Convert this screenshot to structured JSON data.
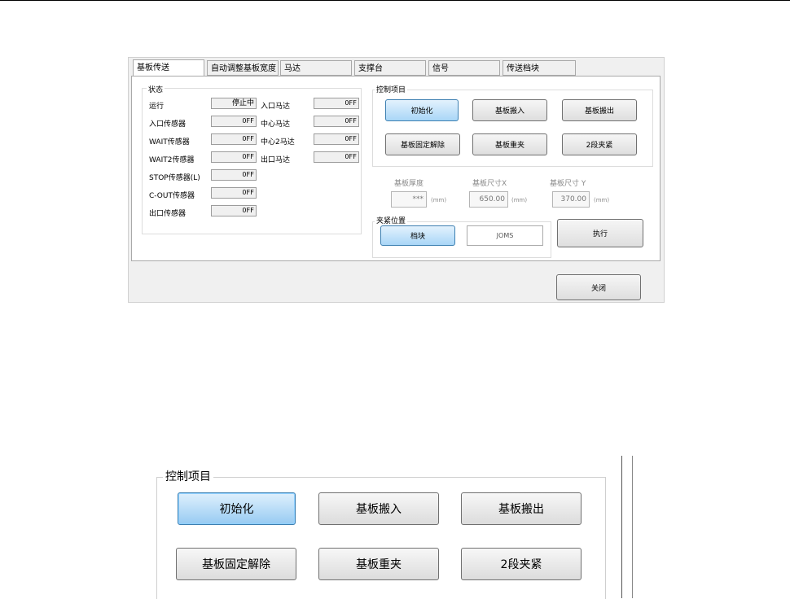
{
  "tabs": [
    "基板传送",
    "自动调整基板宽度",
    "马达",
    "支撑台",
    "信号",
    "传送档块"
  ],
  "status": {
    "title": "状态",
    "left": [
      {
        "label": "运行",
        "value": "停止中"
      },
      {
        "label": "入口传感器",
        "value": "OFF"
      },
      {
        "label": "WAIT传感器",
        "value": "OFF"
      },
      {
        "label": "WAIT2传感器",
        "value": "OFF"
      },
      {
        "label": "STOP传感器(L)",
        "value": "OFF"
      },
      {
        "label": "C-OUT传感器",
        "value": "OFF"
      },
      {
        "label": "出口传感器",
        "value": "OFF"
      }
    ],
    "right": [
      {
        "label": "入口马达",
        "value": "OFF"
      },
      {
        "label": "中心马达",
        "value": "OFF"
      },
      {
        "label": "中心2马达",
        "value": "OFF"
      },
      {
        "label": "出口马达",
        "value": "OFF"
      }
    ]
  },
  "control": {
    "title": "控制项目",
    "buttons": [
      "初始化",
      "基板搬入",
      "基板搬出",
      "基板固定解除",
      "基板重夹",
      "2段夹紧"
    ]
  },
  "dimensions": {
    "thickness_label": "基板厚度",
    "thickness_value": "***",
    "size_x_label": "基板尺寸X",
    "size_x_value": "650.00",
    "size_y_label": "基板尺寸 Y",
    "size_y_value": "370.00",
    "unit": "(mm)"
  },
  "clamp": {
    "title": "夹紧位置",
    "options": [
      "档块",
      "JOMS"
    ],
    "execute": "执行"
  },
  "close_label": "关闭",
  "colors": {
    "selected_button": "#a9d6f7",
    "panel_bg": "#f0f0f0"
  }
}
